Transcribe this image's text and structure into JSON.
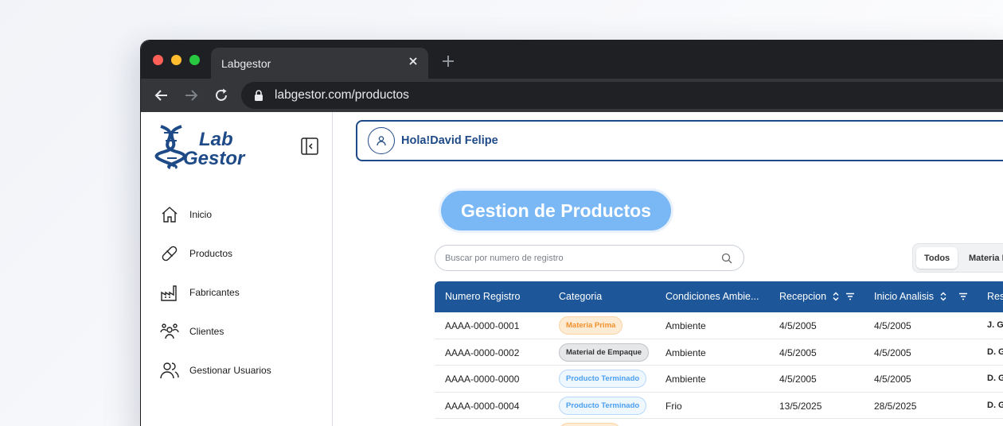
{
  "browser": {
    "tab_title": "Labgestor",
    "url": "labgestor.com/productos"
  },
  "logo": {
    "line1": "Lab",
    "line2": "Gestor"
  },
  "sidebar": {
    "items": [
      {
        "label": "Inicio",
        "icon": "home-icon"
      },
      {
        "label": "Productos",
        "icon": "pill-icon"
      },
      {
        "label": "Fabricantes",
        "icon": "factory-icon"
      },
      {
        "label": "Clientes",
        "icon": "clients-icon"
      },
      {
        "label": "Gestionar Usuarios",
        "icon": "users-icon"
      }
    ]
  },
  "header": {
    "greeting": "Hola!David Felipe"
  },
  "page": {
    "title": "Gestion de Productos"
  },
  "search": {
    "placeholder": "Buscar por numero de registro"
  },
  "filters": {
    "items": [
      "Todos",
      "Materia Prima"
    ],
    "active": "Todos"
  },
  "table": {
    "columns": [
      "Numero Registro",
      "Categoria",
      "Condiciones Ambie...",
      "Recepcion",
      "Inicio Analisis",
      "Res"
    ],
    "rows": [
      {
        "registro": "AAAA-0000-0001",
        "categoria": "Materia Prima",
        "condiciones": "Ambiente",
        "recepcion": "4/5/2005",
        "inicio": "4/5/2005",
        "responsable": "J. G"
      },
      {
        "registro": "AAAA-0000-0002",
        "categoria": "Material de Empaque",
        "condiciones": "Ambiente",
        "recepcion": "4/5/2005",
        "inicio": "4/5/2005",
        "responsable": "D. G"
      },
      {
        "registro": "AAAA-0000-0000",
        "categoria": "Producto Terminado",
        "condiciones": "Ambiente",
        "recepcion": "4/5/2005",
        "inicio": "4/5/2005",
        "responsable": "D. G"
      },
      {
        "registro": "AAAA-0000-0004",
        "categoria": "Producto Terminado",
        "condiciones": "Frio",
        "recepcion": "13/5/2025",
        "inicio": "28/5/2025",
        "responsable": "D. G"
      }
    ]
  },
  "colors": {
    "brand": "#1e4a87",
    "header_blue": "#1e5799",
    "title_pill": "#7ab8f5",
    "materia_prima": "#f5a24a",
    "material_empaque": "#555555",
    "producto_terminado": "#4a9ff0"
  }
}
